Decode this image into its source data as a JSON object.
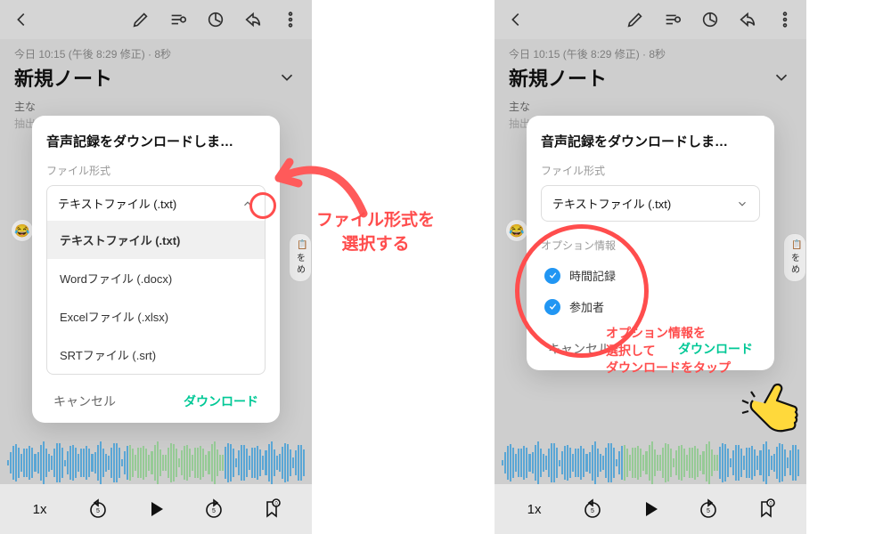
{
  "meta_line": "今日 10:15 (午後 8:29 修正) · 8秒",
  "title": "新規ノート",
  "subtitle_a": "主な",
  "subtitle_b": "抽出",
  "modal": {
    "title": "音声記録をダウンロードしま…",
    "format_label": "ファイル形式",
    "selected": "テキストファイル (.txt)",
    "options": [
      "テキストファイル (.txt)",
      "Wordファイル (.docx)",
      "Excelファイル (.xlsx)",
      "SRTファイル (.srt)"
    ],
    "options_label": "オプション情報",
    "opt_time": "時間記録",
    "opt_participant": "参加者",
    "cancel": "キャンセル",
    "download": "ダウンロード"
  },
  "player": {
    "speed": "1x"
  },
  "side_chip": {
    "text": "を\nめ"
  },
  "annotations": {
    "a1": "ファイル形式を\n選択する",
    "a2": "オプション情報を\n選択して\nダウンロードをタップ"
  }
}
